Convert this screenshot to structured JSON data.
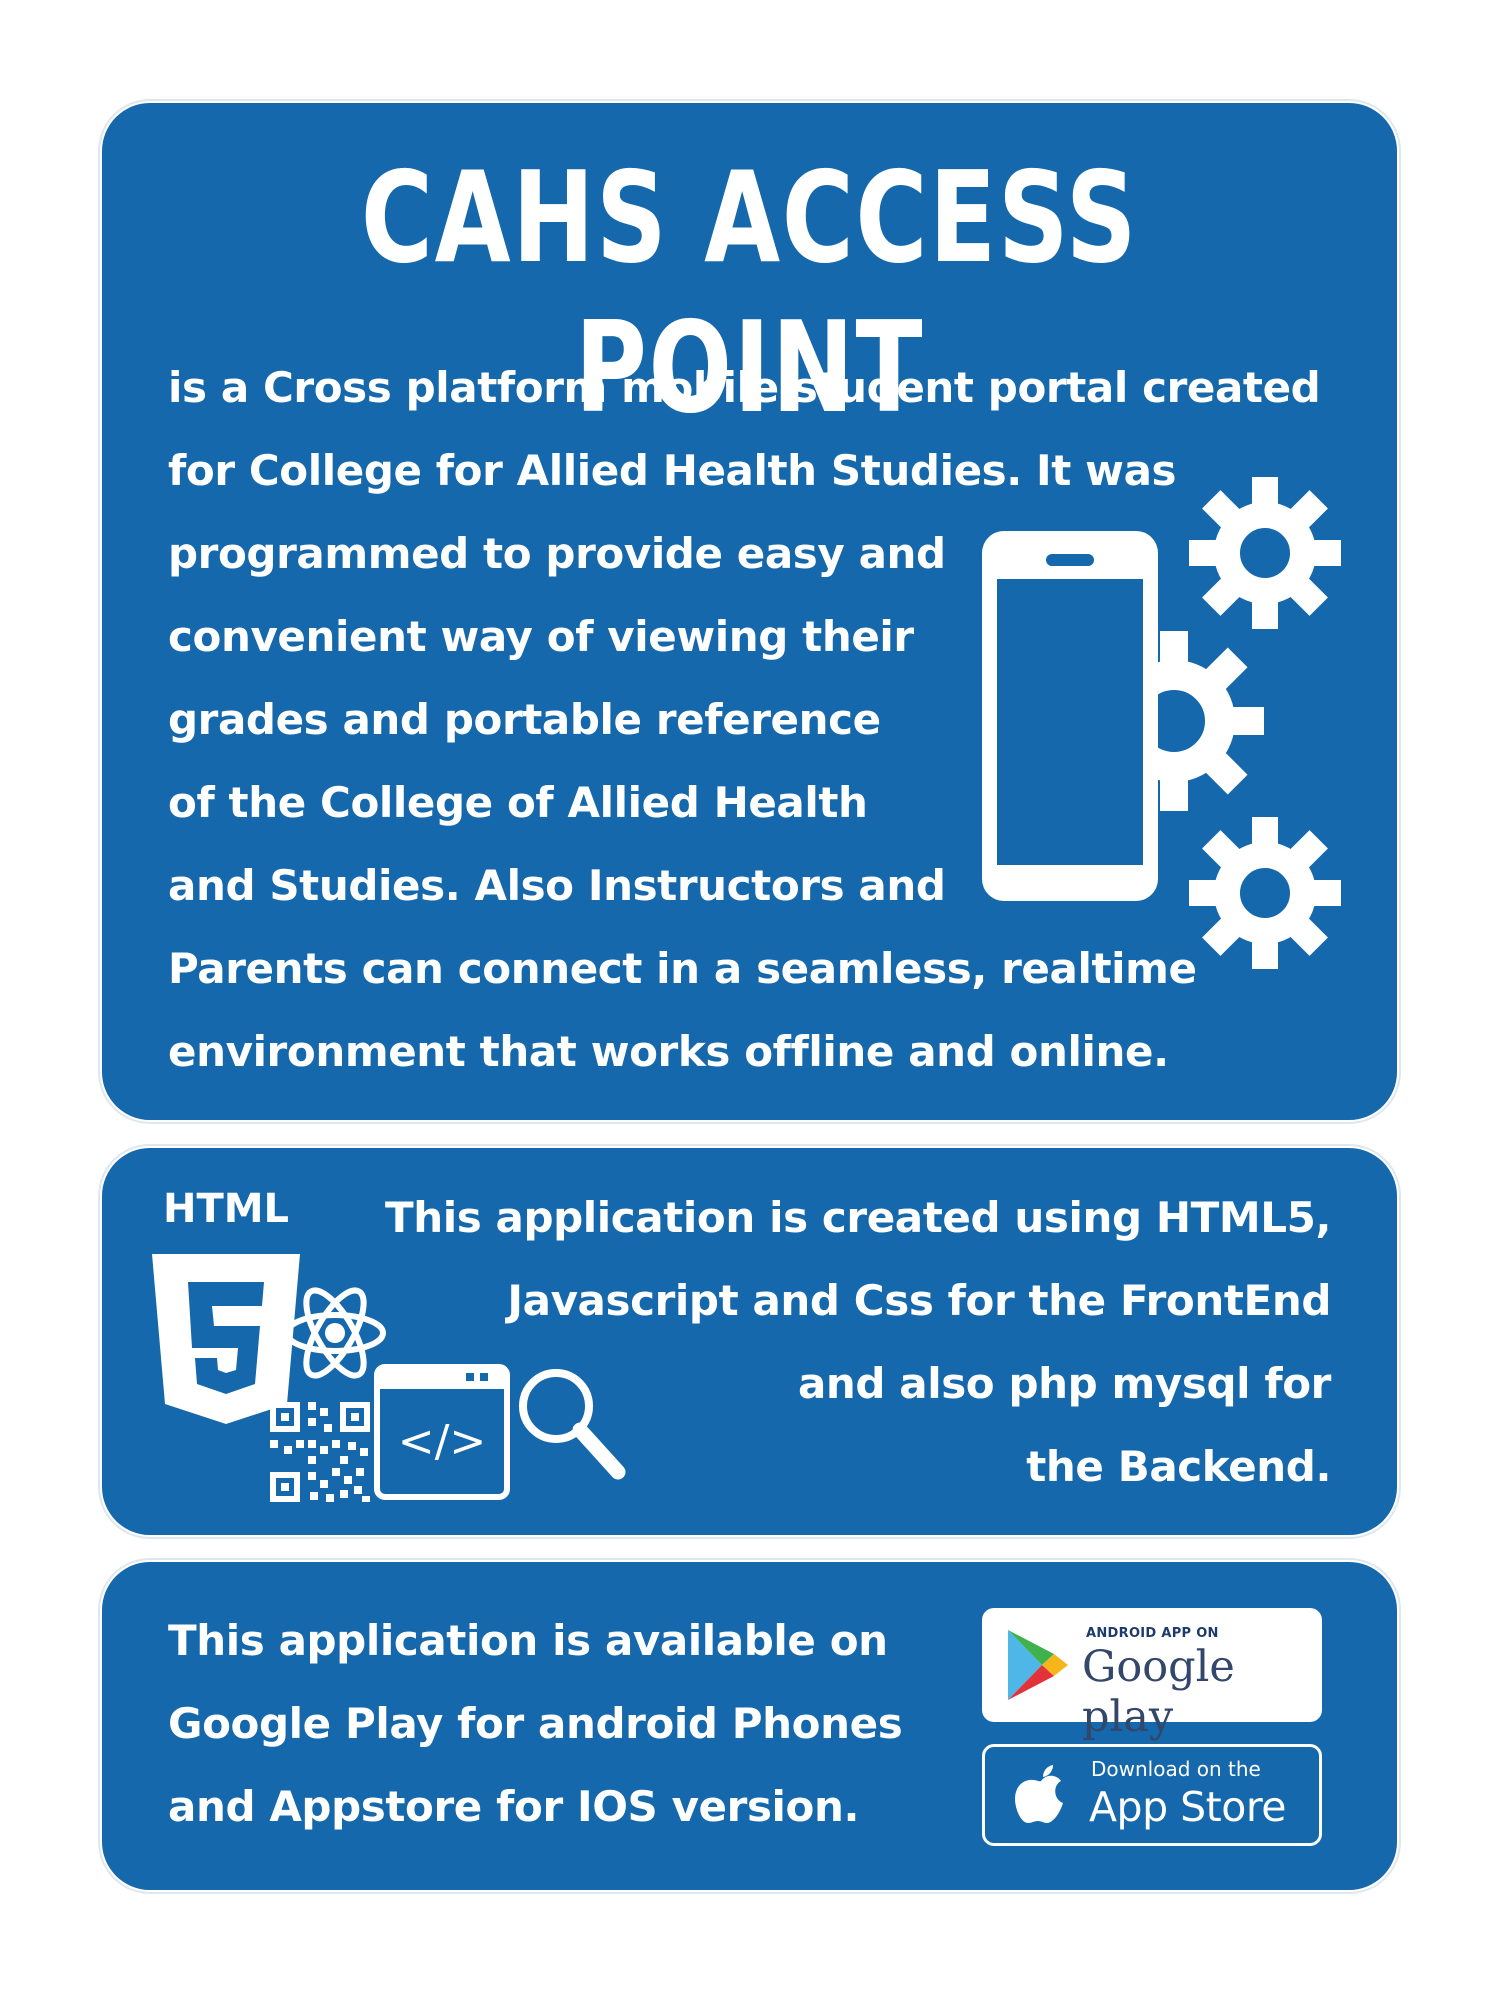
{
  "header": {
    "title": "CAHS ACCESS POINT"
  },
  "intro": {
    "lines": [
      "is a Cross platform mobile student portal created",
      "for College for Allied Health Studies. It was",
      "programmed to provide easy and",
      "convenient way of viewing their",
      "grades and portable reference",
      "of the College of Allied Health",
      "and Studies. Also Instructors and",
      "Parents can connect in a seamless, realtime",
      "environment that works offline and online."
    ]
  },
  "tech": {
    "html_label": "HTML",
    "html_number": "5",
    "code_symbol": "</>",
    "lines": [
      "This application is created using HTML5,",
      "Javascript and Css for the FrontEnd",
      "and also php mysql for",
      "the Backend."
    ]
  },
  "availability": {
    "lines": [
      "This application is available on",
      "Google Play for android Phones",
      "and Appstore for IOS version."
    ],
    "google_play": {
      "small": "ANDROID APP ON",
      "big": "Google play"
    },
    "app_store": {
      "small": "Download on the",
      "big": "App Store"
    }
  }
}
